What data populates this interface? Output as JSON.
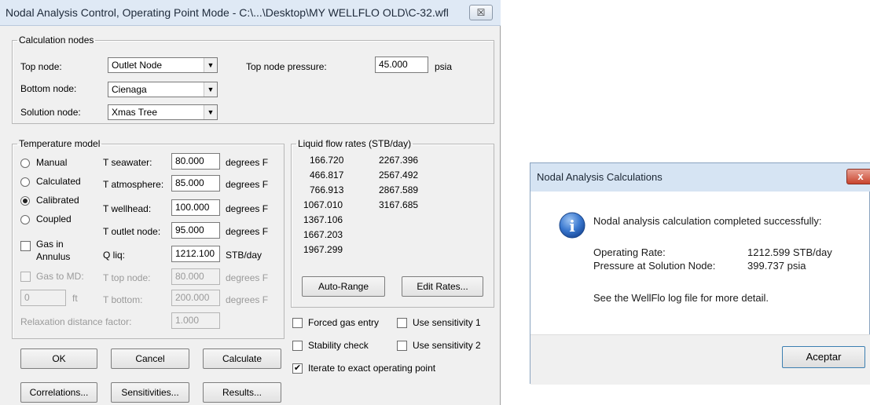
{
  "dialog": {
    "title": "Nodal Analysis Control, Operating Point Mode - C:\\...\\Desktop\\MY WELLFLO OLD\\C-32.wfl",
    "close": "☒",
    "calc_nodes": {
      "legend": "Calculation nodes",
      "top_node_label": "Top node:",
      "top_node_value": "Outlet Node",
      "bottom_node_label": "Bottom node:",
      "bottom_node_value": "Cienaga",
      "solution_node_label": "Solution node:",
      "solution_node_value": "Xmas Tree",
      "top_pressure_label": "Top node pressure:",
      "top_pressure_value": "45.000",
      "top_pressure_unit": "psia"
    },
    "temp_model": {
      "legend": "Temperature model",
      "modes": [
        "Manual",
        "Calculated",
        "Calibrated",
        "Coupled"
      ],
      "selected_mode": "Calibrated",
      "gas_in_annulus_1": "Gas in",
      "gas_in_annulus_2": "Annulus",
      "gas_to_md": "Gas to MD:",
      "md_value": "0",
      "md_unit": "ft",
      "fields": [
        {
          "label": "T seawater:",
          "value": "80.000",
          "unit": "degrees F"
        },
        {
          "label": "T atmosphere:",
          "value": "85.000",
          "unit": "degrees F"
        },
        {
          "label": "T wellhead:",
          "value": "100.000",
          "unit": "degrees F"
        },
        {
          "label": "T outlet node:",
          "value": "95.000",
          "unit": "degrees F"
        },
        {
          "label": "Q liq:",
          "value": "1212.100",
          "unit": "STB/day"
        },
        {
          "label": "T top node:",
          "value": "80.000",
          "unit": "degrees F"
        },
        {
          "label": "T bottom:",
          "value": "200.000",
          "unit": "degrees F"
        }
      ],
      "relax_label": "Relaxation distance factor:",
      "relax_value": "1.000"
    },
    "liquid_rates": {
      "legend": "Liquid flow rates (STB/day)",
      "col1": [
        "166.720",
        "466.817",
        "766.913",
        "1067.010",
        "1367.106",
        "1667.203",
        "1967.299"
      ],
      "col2": [
        "2267.396",
        "2567.492",
        "2867.589",
        "3167.685"
      ],
      "auto_range": "Auto-Range",
      "edit_rates": "Edit Rates..."
    },
    "options": {
      "forced_gas_entry": "Forced gas entry",
      "use_sensitivity_1": "Use sensitivity 1",
      "stability_check": "Stability check",
      "use_sensitivity_2": "Use sensitivity 2",
      "iterate": "Iterate to exact operating point",
      "iterate_check": "✔"
    },
    "buttons": {
      "ok": "OK",
      "cancel": "Cancel",
      "calculate": "Calculate",
      "correlations": "Correlations...",
      "sensitivities": "Sensitivities...",
      "results": "Results..."
    }
  },
  "message_box": {
    "title": "Nodal Analysis Calculations",
    "close": "x",
    "info_icon": "i",
    "headline": "Nodal analysis calculation completed successfully:",
    "rate_label": "Operating Rate:",
    "rate_value": "1212.599 STB/day",
    "pressure_label": "Pressure at Solution Node:",
    "pressure_value": "399.737 psia",
    "note": "See the WellFlo log file for more detail.",
    "ok_button": "Aceptar"
  }
}
